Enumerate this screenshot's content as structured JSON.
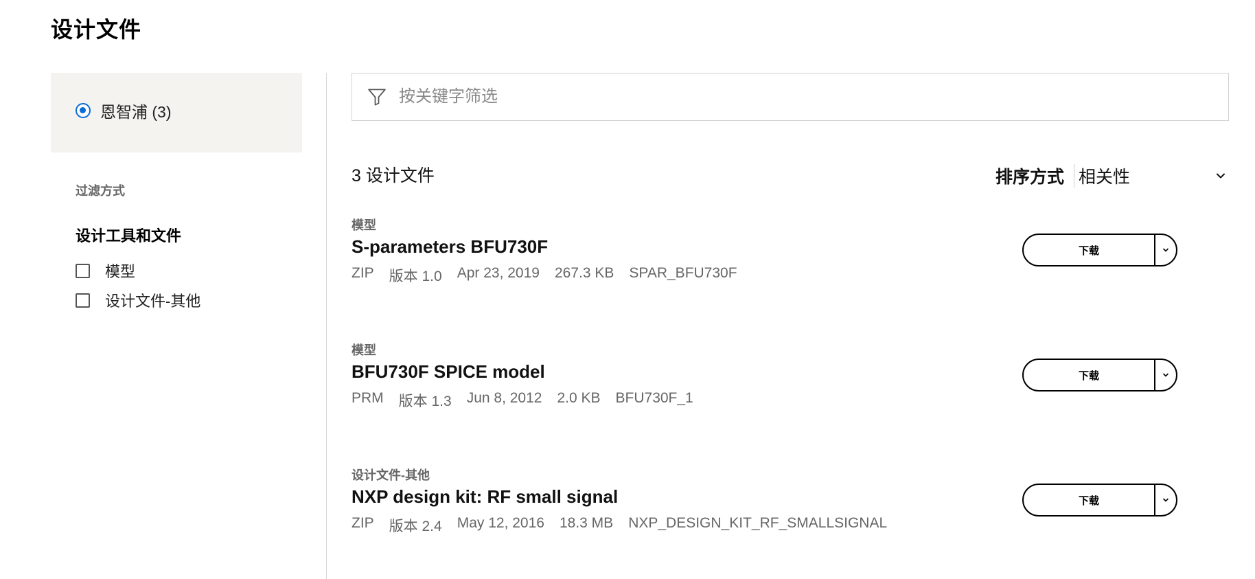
{
  "page_title": "设计文件",
  "sidebar": {
    "vendor": {
      "label": "恩智浦 (3)",
      "selected": true
    },
    "filter_by_label": "过滤方式",
    "filter_group": {
      "title": "设计工具和文件",
      "options": [
        {
          "label": "模型",
          "checked": false
        },
        {
          "label": "设计文件-其他",
          "checked": false
        }
      ]
    }
  },
  "search": {
    "placeholder": "按关键字筛选",
    "value": "",
    "icon": "filter-icon"
  },
  "results": {
    "count_label": "3 设计文件",
    "sort_label": "排序方式",
    "sort_value": "相关性"
  },
  "documents": [
    {
      "category": "模型",
      "title": "S-parameters BFU730F",
      "meta": [
        "ZIP",
        "版本 1.0",
        "Apr 23, 2019",
        "267.3 KB",
        "SPAR_BFU730F"
      ],
      "download_label": "下载"
    },
    {
      "category": "模型",
      "title": "BFU730F SPICE model",
      "meta": [
        "PRM",
        "版本 1.3",
        "Jun 8, 2012",
        "2.0 KB",
        "BFU730F_1"
      ],
      "download_label": "下载"
    },
    {
      "category": "设计文件-其他",
      "title": "NXP design kit: RF small signal",
      "meta": [
        "ZIP",
        "版本 2.4",
        "May 12, 2016",
        "18.3 MB",
        "NXP_DESIGN_KIT_RF_SMALLSIGNAL"
      ],
      "download_label": "下载"
    }
  ],
  "colors": {
    "accent": "#0a6cd6",
    "sidebar_bg": "#f4f3f0",
    "muted_text": "#666666"
  }
}
